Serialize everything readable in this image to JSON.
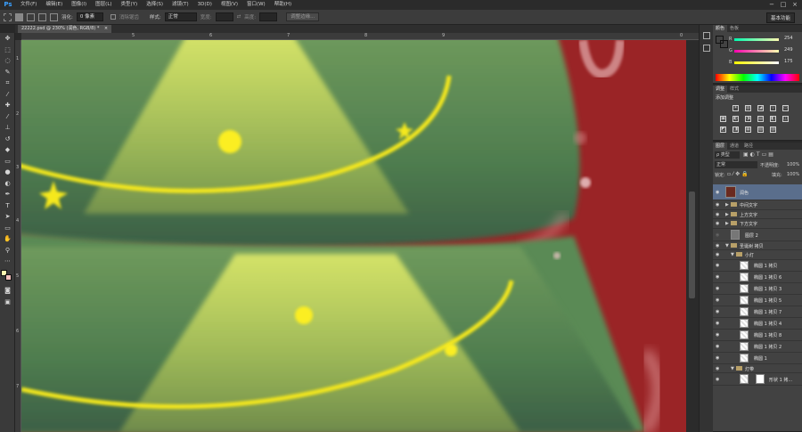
{
  "app": {
    "logo": "Ps"
  },
  "menu": [
    "文件(F)",
    "编辑(E)",
    "图像(I)",
    "图层(L)",
    "类型(Y)",
    "选择(S)",
    "滤镜(T)",
    "3D(D)",
    "视图(V)",
    "窗口(W)",
    "帮助(H)"
  ],
  "window_controls": {
    "minimize": "−",
    "maximize": "□",
    "close": "×"
  },
  "options": {
    "feather_label": "羽化:",
    "feather_value": "0 像素",
    "antialias_label": "消除锯齿",
    "style_label": "样式:",
    "style_value": "正常",
    "width_label": "宽度:",
    "height_label": "高度:",
    "refine_button": "调整边缘...",
    "workspace": "基本功能"
  },
  "document": {
    "tab_title": "22222.psd @ 230% (润色, RGB/8) *",
    "tab_close": "×"
  },
  "rulers": {
    "top": [
      "5",
      "6",
      "7",
      "8",
      "9",
      "0"
    ],
    "left": [
      "1",
      "2",
      "3",
      "4",
      "5",
      "6",
      "7"
    ]
  },
  "color_panel": {
    "tabs": [
      "颜色",
      "色板"
    ],
    "r_label": "R",
    "r_value": "254",
    "g_label": "G",
    "g_value": "249",
    "b_label": "B",
    "b_value": "175",
    "fg_color": "#fef9af",
    "bg_color": "#f4c0bc"
  },
  "adjust_panel": {
    "tabs": [
      "调整",
      "样式"
    ],
    "title": "添加调整",
    "icons_row1": [
      "☀",
      "▥",
      "◪",
      "▽",
      "▭"
    ],
    "icons_row2": [
      "▣",
      "◐",
      "◑",
      "▤",
      "◧",
      "◫"
    ],
    "icons_row3": [
      "◩",
      "◨",
      "▦",
      "▧",
      "▨"
    ]
  },
  "layers_panel": {
    "tabs": [
      "图层",
      "通道",
      "路径"
    ],
    "filter_label": "ρ 类型",
    "blend_mode": "正常",
    "opacity_label": "不透明度:",
    "opacity_value": "100%",
    "lock_label": "锁定:",
    "fill_label": "填充:",
    "fill_value": "100%",
    "layers": [
      {
        "name": "润色",
        "kind": "image",
        "selected": true,
        "indent": 0
      },
      {
        "name": "中间文字",
        "kind": "folder",
        "indent": 0
      },
      {
        "name": "上方文字",
        "kind": "folder",
        "indent": 0
      },
      {
        "name": "下方文字",
        "kind": "folder",
        "indent": 0
      },
      {
        "name": "图层 2",
        "kind": "image",
        "indent": 0
      },
      {
        "name": "圣诞树 拷贝",
        "kind": "folder-open",
        "indent": 0
      },
      {
        "name": "小灯",
        "kind": "folder-open",
        "indent": 1
      },
      {
        "name": "椭圆 1 拷贝",
        "kind": "shape",
        "indent": 2
      },
      {
        "name": "椭圆 1 拷贝 6",
        "kind": "shape",
        "indent": 2
      },
      {
        "name": "椭圆 1 拷贝 3",
        "kind": "shape",
        "indent": 2
      },
      {
        "name": "椭圆 1 拷贝 5",
        "kind": "shape",
        "indent": 2
      },
      {
        "name": "椭圆 1 拷贝 7",
        "kind": "shape",
        "indent": 2
      },
      {
        "name": "椭圆 1 拷贝 4",
        "kind": "shape",
        "indent": 2
      },
      {
        "name": "椭圆 1 拷贝 8",
        "kind": "shape",
        "indent": 2
      },
      {
        "name": "椭圆 1 拷贝 2",
        "kind": "shape",
        "indent": 2
      },
      {
        "name": "椭圆 1",
        "kind": "shape",
        "indent": 2
      },
      {
        "name": "灯带",
        "kind": "folder-open",
        "indent": 1
      },
      {
        "name": "形状 1 拷...",
        "kind": "shape",
        "indent": 2
      }
    ]
  }
}
